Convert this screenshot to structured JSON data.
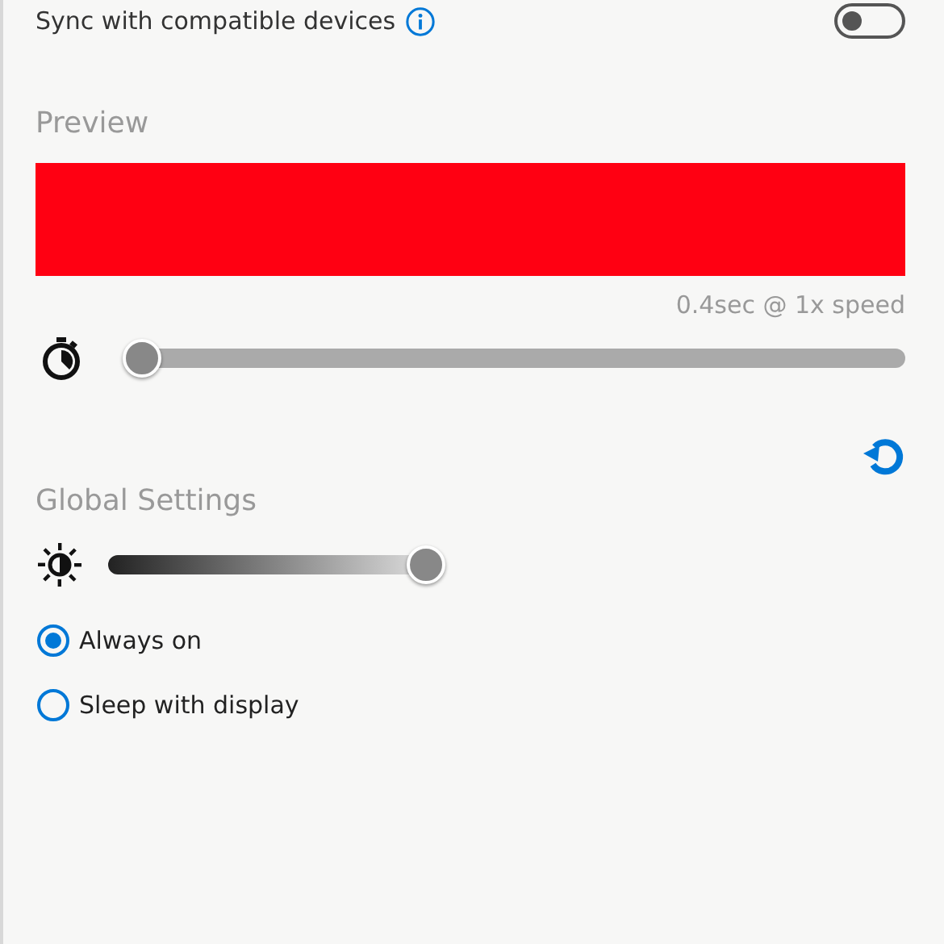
{
  "sync": {
    "label": "Sync with compatible devices",
    "on": false
  },
  "preview": {
    "heading": "Preview",
    "color": "#ff0012",
    "speed_text": "0.4sec @ 1x speed",
    "speed": {
      "level": 0
    }
  },
  "global_settings": {
    "heading": "Global Settings",
    "brightness": {
      "level": 1
    },
    "options": [
      {
        "label": "Always on",
        "selected": true
      },
      {
        "label": "Sleep with display",
        "selected": false
      }
    ]
  }
}
